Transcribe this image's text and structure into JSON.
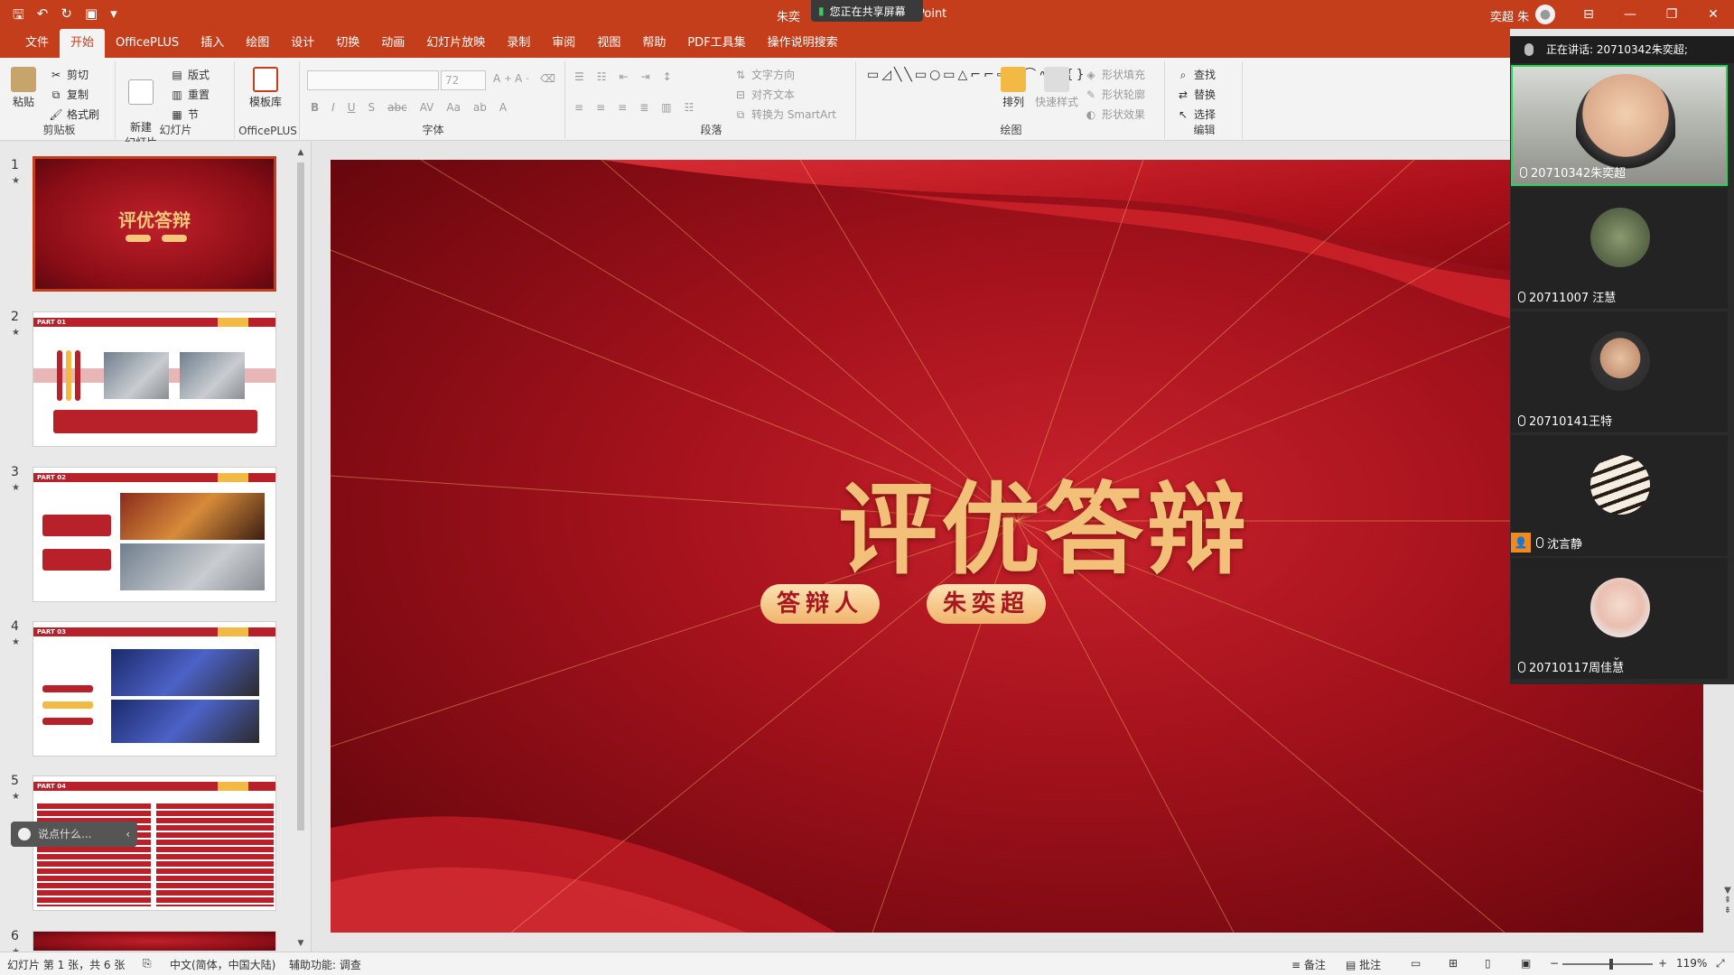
{
  "titlebar": {
    "doc_title_left": "朱奕",
    "doc_title_right": "Point",
    "share_banner": "您正在共享屏幕",
    "user_name": "奕超 朱",
    "win_minimize": "—",
    "win_restore": "❐",
    "win_close": "✕"
  },
  "tabs": [
    "文件",
    "开始",
    "OfficePLUS",
    "插入",
    "绘图",
    "设计",
    "切换",
    "动画",
    "幻灯片放映",
    "录制",
    "审阅",
    "视图",
    "帮助",
    "PDF工具集",
    "操作说明搜索"
  ],
  "ribbon": {
    "clipboard": {
      "paste": "粘贴",
      "cut": "剪切",
      "copy": "复制",
      "format_painter": "格式刷",
      "label": "剪贴板"
    },
    "slides": {
      "new_slide": "新建\n幻灯片",
      "layout": "版式",
      "reset": "重置",
      "section": "节",
      "label": "幻灯片"
    },
    "officeplus": {
      "templates": "模板库",
      "label": "OfficePLUS"
    },
    "font": {
      "font_name": "",
      "font_size": "72",
      "label": "字体"
    },
    "paragraph": {
      "text_direction": "文字方向",
      "align_text": "对齐文本",
      "smartart": "转换为 SmartArt",
      "label": "段落"
    },
    "drawing": {
      "arrange": "排列",
      "quick_styles": "快速样式",
      "shape_fill": "形状填充",
      "shape_outline": "形状轮廓",
      "shape_effects": "形状效果",
      "label": "绘图"
    },
    "editing": {
      "find": "查找",
      "replace": "替换",
      "select": "选择",
      "label": "编辑"
    }
  },
  "thumbnails": [
    {
      "num": "1",
      "title": "评优答辩"
    },
    {
      "num": "2",
      "part": "PART 01"
    },
    {
      "num": "3",
      "part": "PART 02"
    },
    {
      "num": "4",
      "part": "PART 03"
    },
    {
      "num": "5",
      "part": "PART 04"
    },
    {
      "num": "6"
    }
  ],
  "chat_placeholder": "说点什么...",
  "slide": {
    "title": "评优答辩",
    "pill_left": "答辩人",
    "pill_right": "朱奕超"
  },
  "video": {
    "speaking": "正在讲话: 20710342朱奕超;",
    "participants": [
      {
        "name": "20710342朱奕超"
      },
      {
        "name": "20711007 汪慧"
      },
      {
        "name": "20710141王特"
      },
      {
        "name": "沈言静"
      },
      {
        "name": "20710117周佳慧"
      }
    ]
  },
  "statusbar": {
    "slide_info": "幻灯片 第 1 张，共 6 张",
    "language": "中文(简体，中国大陆)",
    "accessibility": "辅助功能: 调查",
    "notes": "备注",
    "comments": "批注",
    "zoom": "119%"
  },
  "colors": {
    "accent": "#c43e1c",
    "active_speaker": "#2fd15a"
  }
}
